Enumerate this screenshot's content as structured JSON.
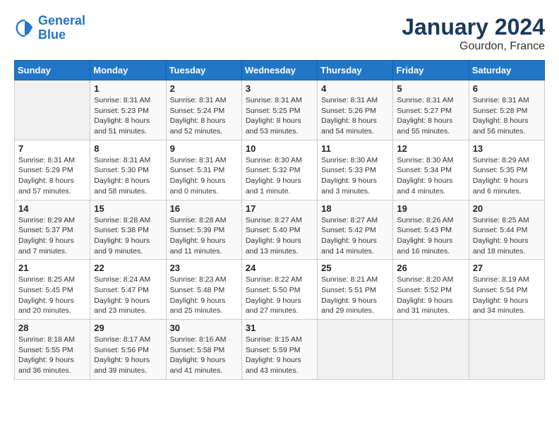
{
  "logo": {
    "line1": "General",
    "line2": "Blue"
  },
  "title": "January 2024",
  "location": "Gourdon, France",
  "days_header": [
    "Sunday",
    "Monday",
    "Tuesday",
    "Wednesday",
    "Thursday",
    "Friday",
    "Saturday"
  ],
  "weeks": [
    [
      {
        "num": "",
        "sunrise": "",
        "sunset": "",
        "daylight": ""
      },
      {
        "num": "1",
        "sunrise": "Sunrise: 8:31 AM",
        "sunset": "Sunset: 5:23 PM",
        "daylight": "Daylight: 8 hours and 51 minutes."
      },
      {
        "num": "2",
        "sunrise": "Sunrise: 8:31 AM",
        "sunset": "Sunset: 5:24 PM",
        "daylight": "Daylight: 8 hours and 52 minutes."
      },
      {
        "num": "3",
        "sunrise": "Sunrise: 8:31 AM",
        "sunset": "Sunset: 5:25 PM",
        "daylight": "Daylight: 8 hours and 53 minutes."
      },
      {
        "num": "4",
        "sunrise": "Sunrise: 8:31 AM",
        "sunset": "Sunset: 5:26 PM",
        "daylight": "Daylight: 8 hours and 54 minutes."
      },
      {
        "num": "5",
        "sunrise": "Sunrise: 8:31 AM",
        "sunset": "Sunset: 5:27 PM",
        "daylight": "Daylight: 8 hours and 55 minutes."
      },
      {
        "num": "6",
        "sunrise": "Sunrise: 8:31 AM",
        "sunset": "Sunset: 5:28 PM",
        "daylight": "Daylight: 8 hours and 56 minutes."
      }
    ],
    [
      {
        "num": "7",
        "sunrise": "Sunrise: 8:31 AM",
        "sunset": "Sunset: 5:29 PM",
        "daylight": "Daylight: 8 hours and 57 minutes."
      },
      {
        "num": "8",
        "sunrise": "Sunrise: 8:31 AM",
        "sunset": "Sunset: 5:30 PM",
        "daylight": "Daylight: 8 hours and 58 minutes."
      },
      {
        "num": "9",
        "sunrise": "Sunrise: 8:31 AM",
        "sunset": "Sunset: 5:31 PM",
        "daylight": "Daylight: 9 hours and 0 minutes."
      },
      {
        "num": "10",
        "sunrise": "Sunrise: 8:30 AM",
        "sunset": "Sunset: 5:32 PM",
        "daylight": "Daylight: 9 hours and 1 minute."
      },
      {
        "num": "11",
        "sunrise": "Sunrise: 8:30 AM",
        "sunset": "Sunset: 5:33 PM",
        "daylight": "Daylight: 9 hours and 3 minutes."
      },
      {
        "num": "12",
        "sunrise": "Sunrise: 8:30 AM",
        "sunset": "Sunset: 5:34 PM",
        "daylight": "Daylight: 9 hours and 4 minutes."
      },
      {
        "num": "13",
        "sunrise": "Sunrise: 8:29 AM",
        "sunset": "Sunset: 5:35 PM",
        "daylight": "Daylight: 9 hours and 6 minutes."
      }
    ],
    [
      {
        "num": "14",
        "sunrise": "Sunrise: 8:29 AM",
        "sunset": "Sunset: 5:37 PM",
        "daylight": "Daylight: 9 hours and 7 minutes."
      },
      {
        "num": "15",
        "sunrise": "Sunrise: 8:28 AM",
        "sunset": "Sunset: 5:38 PM",
        "daylight": "Daylight: 9 hours and 9 minutes."
      },
      {
        "num": "16",
        "sunrise": "Sunrise: 8:28 AM",
        "sunset": "Sunset: 5:39 PM",
        "daylight": "Daylight: 9 hours and 11 minutes."
      },
      {
        "num": "17",
        "sunrise": "Sunrise: 8:27 AM",
        "sunset": "Sunset: 5:40 PM",
        "daylight": "Daylight: 9 hours and 13 minutes."
      },
      {
        "num": "18",
        "sunrise": "Sunrise: 8:27 AM",
        "sunset": "Sunset: 5:42 PM",
        "daylight": "Daylight: 9 hours and 14 minutes."
      },
      {
        "num": "19",
        "sunrise": "Sunrise: 8:26 AM",
        "sunset": "Sunset: 5:43 PM",
        "daylight": "Daylight: 9 hours and 16 minutes."
      },
      {
        "num": "20",
        "sunrise": "Sunrise: 8:25 AM",
        "sunset": "Sunset: 5:44 PM",
        "daylight": "Daylight: 9 hours and 18 minutes."
      }
    ],
    [
      {
        "num": "21",
        "sunrise": "Sunrise: 8:25 AM",
        "sunset": "Sunset: 5:45 PM",
        "daylight": "Daylight: 9 hours and 20 minutes."
      },
      {
        "num": "22",
        "sunrise": "Sunrise: 8:24 AM",
        "sunset": "Sunset: 5:47 PM",
        "daylight": "Daylight: 9 hours and 23 minutes."
      },
      {
        "num": "23",
        "sunrise": "Sunrise: 8:23 AM",
        "sunset": "Sunset: 5:48 PM",
        "daylight": "Daylight: 9 hours and 25 minutes."
      },
      {
        "num": "24",
        "sunrise": "Sunrise: 8:22 AM",
        "sunset": "Sunset: 5:50 PM",
        "daylight": "Daylight: 9 hours and 27 minutes."
      },
      {
        "num": "25",
        "sunrise": "Sunrise: 8:21 AM",
        "sunset": "Sunset: 5:51 PM",
        "daylight": "Daylight: 9 hours and 29 minutes."
      },
      {
        "num": "26",
        "sunrise": "Sunrise: 8:20 AM",
        "sunset": "Sunset: 5:52 PM",
        "daylight": "Daylight: 9 hours and 31 minutes."
      },
      {
        "num": "27",
        "sunrise": "Sunrise: 8:19 AM",
        "sunset": "Sunset: 5:54 PM",
        "daylight": "Daylight: 9 hours and 34 minutes."
      }
    ],
    [
      {
        "num": "28",
        "sunrise": "Sunrise: 8:18 AM",
        "sunset": "Sunset: 5:55 PM",
        "daylight": "Daylight: 9 hours and 36 minutes."
      },
      {
        "num": "29",
        "sunrise": "Sunrise: 8:17 AM",
        "sunset": "Sunset: 5:56 PM",
        "daylight": "Daylight: 9 hours and 39 minutes."
      },
      {
        "num": "30",
        "sunrise": "Sunrise: 8:16 AM",
        "sunset": "Sunset: 5:58 PM",
        "daylight": "Daylight: 9 hours and 41 minutes."
      },
      {
        "num": "31",
        "sunrise": "Sunrise: 8:15 AM",
        "sunset": "Sunset: 5:59 PM",
        "daylight": "Daylight: 9 hours and 43 minutes."
      },
      {
        "num": "",
        "sunrise": "",
        "sunset": "",
        "daylight": ""
      },
      {
        "num": "",
        "sunrise": "",
        "sunset": "",
        "daylight": ""
      },
      {
        "num": "",
        "sunrise": "",
        "sunset": "",
        "daylight": ""
      }
    ]
  ]
}
